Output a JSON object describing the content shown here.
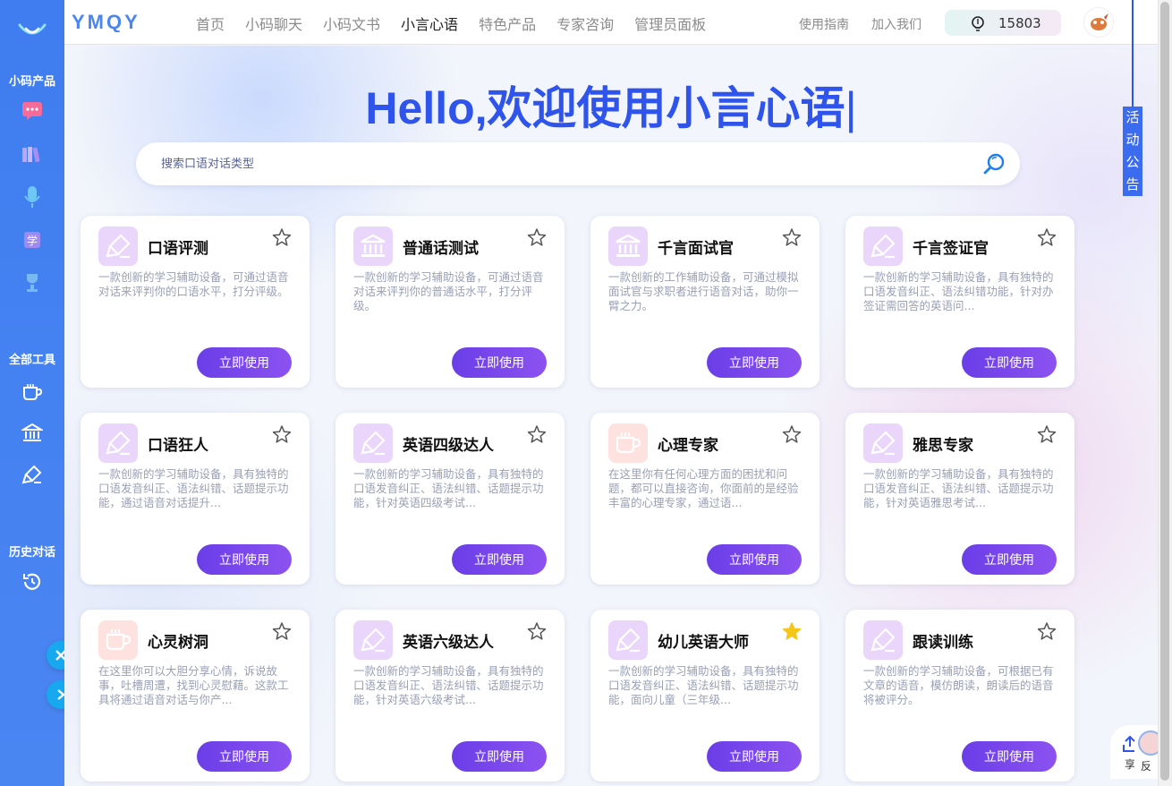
{
  "sidebar": {
    "section_products": "小码产品",
    "section_tools": "全部工具",
    "section_history": "历史对话",
    "product_icons": [
      "chat-icon",
      "books-icon",
      "microphone-icon",
      "study-icon",
      "trophy-icon"
    ],
    "tool_icons": [
      "coffee-cup-icon",
      "bank-icon",
      "brush-icon"
    ],
    "history_icon": "history-icon"
  },
  "header": {
    "brand": "YMQY",
    "nav": [
      {
        "label": "首页",
        "active": false
      },
      {
        "label": "小码聊天",
        "active": false
      },
      {
        "label": "小码文书",
        "active": false
      },
      {
        "label": "小言心语",
        "active": true
      },
      {
        "label": "特色产品",
        "active": false
      },
      {
        "label": "专家咨询",
        "active": false
      },
      {
        "label": "管理员面板",
        "active": false
      }
    ],
    "guide": "使用指南",
    "join": "加入我们",
    "points": "15803"
  },
  "hero": {
    "title": "Hello,欢迎使用小言心语",
    "caret": "|"
  },
  "search": {
    "placeholder": "搜索口语对话类型"
  },
  "cards": [
    {
      "title": "口语评测",
      "icon": "purple",
      "starred": false,
      "desc": "一款创新的学习辅助设备，可通过语音对话来评判你的口语水平，打分评级。",
      "btn": "立即使用"
    },
    {
      "title": "普通话测试",
      "icon": "bank",
      "starred": false,
      "desc": "一款创新的学习辅助设备，可通过语音对话来评判你的普通话水平，打分评级。",
      "btn": "立即使用"
    },
    {
      "title": "千言面试官",
      "icon": "bank",
      "starred": false,
      "desc": "一款创新的工作辅助设备，可通过模拟面试官与求职者进行语音对话，助你一臂之力。",
      "btn": "立即使用"
    },
    {
      "title": "千言签证官",
      "icon": "purple",
      "starred": false,
      "desc": "一款创新的学习辅助设备，具有独特的口语发音纠正、语法纠错功能，针对办签证需回答的英语问...",
      "btn": "立即使用"
    },
    {
      "title": "口语狂人",
      "icon": "purple",
      "starred": false,
      "desc": "一款创新的学习辅助设备，具有独特的口语发音纠正、语法纠错、话题提示功能，通过语音对话提升...",
      "btn": "立即使用"
    },
    {
      "title": "英语四级达人",
      "icon": "purple",
      "starred": false,
      "desc": "一款创新的学习辅助设备，具有独特的口语发音纠正、语法纠错、话题提示功能，针对英语四级考试...",
      "btn": "立即使用"
    },
    {
      "title": "心理专家",
      "icon": "peach",
      "starred": false,
      "desc": "在这里你有任何心理方面的困扰和问题，都可以直接咨询，你面前的是经验丰富的心理专家，通过语...",
      "btn": "立即使用"
    },
    {
      "title": "雅思专家",
      "icon": "purple",
      "starred": false,
      "desc": "一款创新的学习辅助设备，具有独特的口语发音纠正、语法纠错、话题提示功能，针对英语雅思考试...",
      "btn": "立即使用"
    },
    {
      "title": "心灵树洞",
      "icon": "peach",
      "starred": false,
      "desc": "在这里你可以大胆分享心情，诉说故事，吐槽周遭，找到心灵慰藉。这款工具将通过语音对话与你产...",
      "btn": "立即使用"
    },
    {
      "title": "英语六级达人",
      "icon": "purple",
      "starred": false,
      "desc": "一款创新的学习辅助设备，具有独特的口语发音纠正、语法纠错、话题提示功能，针对英语六级考试...",
      "btn": "立即使用"
    },
    {
      "title": "幼儿英语大师",
      "icon": "purple",
      "starred": true,
      "desc": "一款创新的学习辅助设备，具有独特的口语发音纠正、语法纠错、话题提示功能，面向儿童（三年级...",
      "btn": "立即使用"
    },
    {
      "title": "跟读训练",
      "icon": "purple",
      "starred": false,
      "desc": "一款创新的学习辅助设备，可根据已有文章的语音，模仿朗读，朗读后的语音将被评分。",
      "btn": "立即使用"
    }
  ],
  "notice": "活动公告",
  "corner": {
    "share": "享",
    "feedback": "反"
  },
  "colors": {
    "primary": "#2f54eb",
    "sidebar": "#3f7df0",
    "button": "#7b47ec",
    "star_on": "#f5c518"
  }
}
